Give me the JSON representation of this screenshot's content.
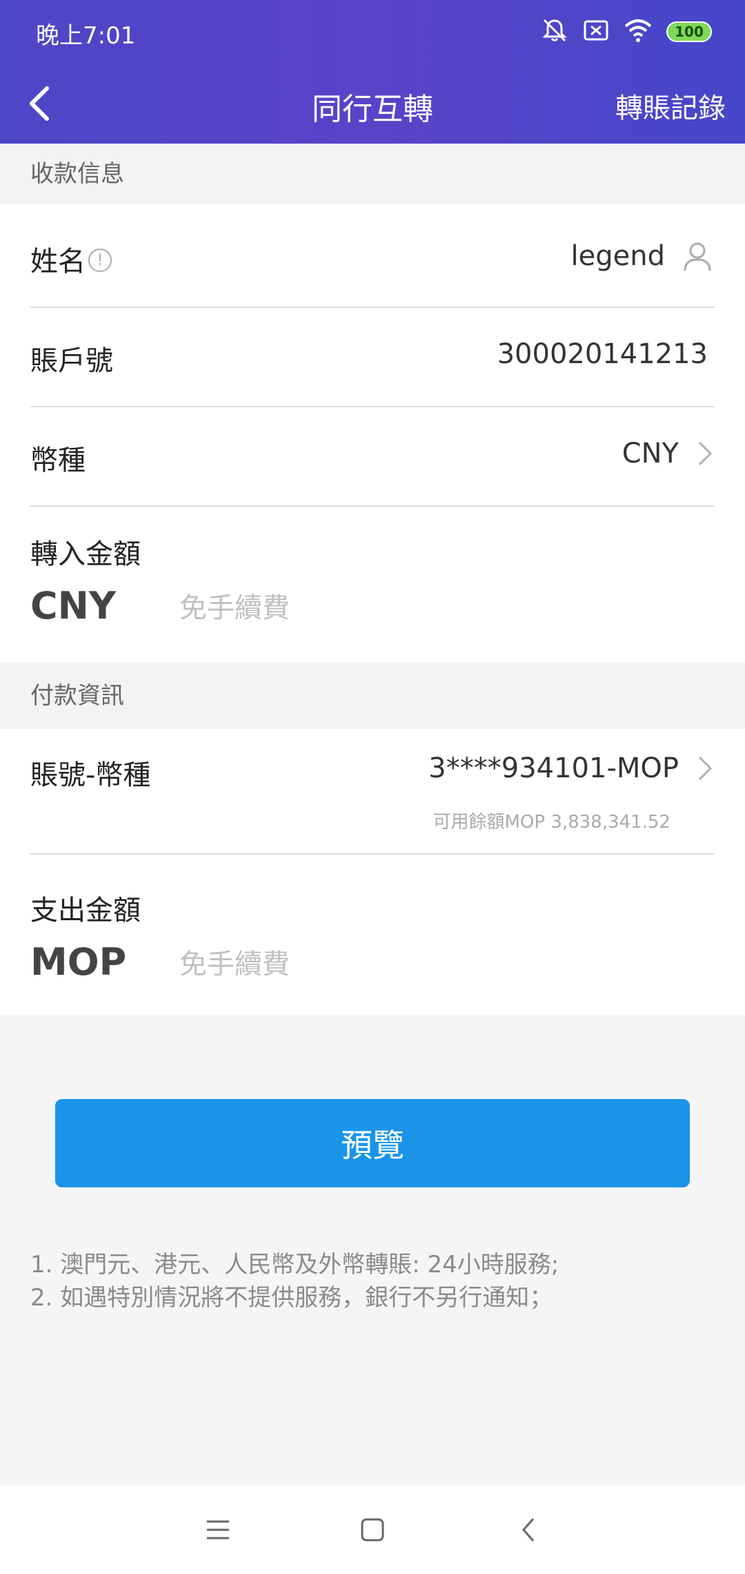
{
  "status_bar": {
    "time": "晚上7:01",
    "battery": "100",
    "icons": [
      "bell-off-icon",
      "sim-off-icon",
      "wifi-icon",
      "battery-icon"
    ]
  },
  "nav": {
    "title": "同行互轉",
    "right_link": "轉賬記錄",
    "back_icon": "chevron-left-icon"
  },
  "receive_section": {
    "title": "收款信息",
    "name_label": "姓名",
    "name_value": "legend",
    "account_label": "賬戶號",
    "account_value": "300020141213",
    "currency_label": "幣種",
    "currency_value": "CNY",
    "amount_label": "轉入金額",
    "amount_currency": "CNY",
    "amount_placeholder": "免手續費"
  },
  "payment_section": {
    "title": "付款資訊",
    "account_currency_label": "賬號-幣種",
    "account_currency_value": "3****934101-MOP",
    "available_balance": "可用餘額MOP 3,838,341.52",
    "amount_label": "支出金額",
    "amount_currency": "MOP",
    "amount_placeholder": "免手續費"
  },
  "preview_button": "預覽",
  "notes": [
    "1. 澳門元、港元、人民幣及外幣轉賬: 24小時服務;",
    "2. 如遇特別情況將不提供服務，銀行不另行通知；"
  ],
  "colors": {
    "header": "#4d46c6",
    "button": "#1a94e8",
    "battery": "#7ed957"
  }
}
